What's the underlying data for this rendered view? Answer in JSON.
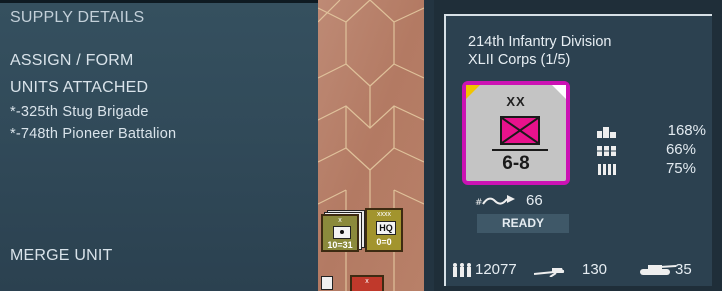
{
  "left_panel": {
    "supply_details": "SUPPLY DETAILS",
    "assign_form": "ASSIGN / FORM",
    "units_attached_heading": "UNITS ATTACHED",
    "attached_units": [
      "*-325th Stug Brigade",
      "*-748th Pioneer Battalion"
    ],
    "merge_unit": "MERGE UNIT"
  },
  "map": {
    "counter_a": {
      "size": "x",
      "value": "10=31"
    },
    "counter_b": {
      "size": "xxxx",
      "label": "HQ",
      "value": "0=0"
    },
    "counter_c": {
      "size": "x"
    }
  },
  "unit": {
    "name": "214th Infantry Division",
    "corps": "XLII Corps (1/5)",
    "counter": {
      "size": "XX",
      "strength": "6-8",
      "border_color": "#cc12b4",
      "symbol_color": "#e8128c",
      "symbol": "infantry-cross"
    },
    "stats": [
      {
        "icon": "supply-icon",
        "value": "168%"
      },
      {
        "icon": "fuel-icon",
        "value": "66%"
      },
      {
        "icon": "ammo-icon",
        "value": "75%"
      }
    ],
    "movement": {
      "icon": "movement-icon",
      "value": "66"
    },
    "status": "READY",
    "manpower": {
      "icon": "manpower-icon",
      "value": "12077"
    },
    "guns": {
      "icon": "artillery-icon",
      "value": "130"
    },
    "tanks": {
      "icon": "tank-icon",
      "value": "35"
    }
  },
  "colors": {
    "panel": "#314a59",
    "map": "#b9826c",
    "ready_badge": "#3f5868"
  }
}
